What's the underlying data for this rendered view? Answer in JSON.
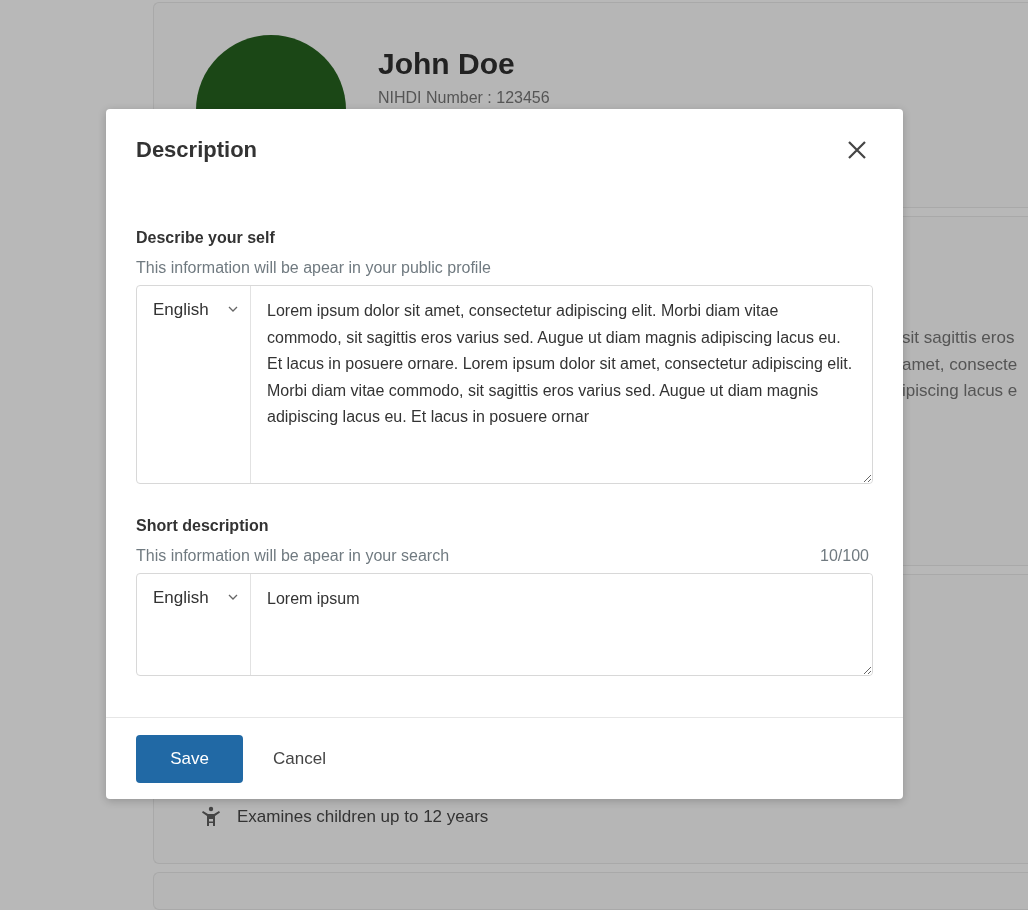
{
  "background": {
    "profile": {
      "name": "John Doe",
      "nihdi": "NIHDI Number : 123456"
    },
    "about_fragments": [
      "sit sagittis eros",
      "amet, consecte",
      "ipiscing lacus e"
    ],
    "features": [
      {
        "kind": "child",
        "text": "Examines children up to 12 years"
      }
    ]
  },
  "dialog": {
    "title": "Description",
    "sections": [
      {
        "label": "Describe your self",
        "hint": "This information will be apear in your public profile",
        "language": "English",
        "value": "Lorem ipsum dolor sit amet, consectetur adipiscing elit. Morbi diam vitae commodo, sit sagittis eros varius sed. Augue ut diam magnis adipiscing lacus eu. Et lacus in posuere ornare. Lorem ipsum dolor sit amet, consectetur adipiscing elit. Morbi diam vitae commodo, sit sagittis eros varius sed. Augue ut diam magnis adipiscing lacus eu. Et lacus in posuere ornar"
      },
      {
        "label": "Short description",
        "hint": "This information will be apear in your search",
        "counter": "10/100",
        "language": "English",
        "value": "Lorem ipsum"
      }
    ],
    "buttons": [
      {
        "kind": "primary",
        "label": "Save"
      },
      {
        "kind": "secondary",
        "label": "Cancel"
      }
    ]
  }
}
